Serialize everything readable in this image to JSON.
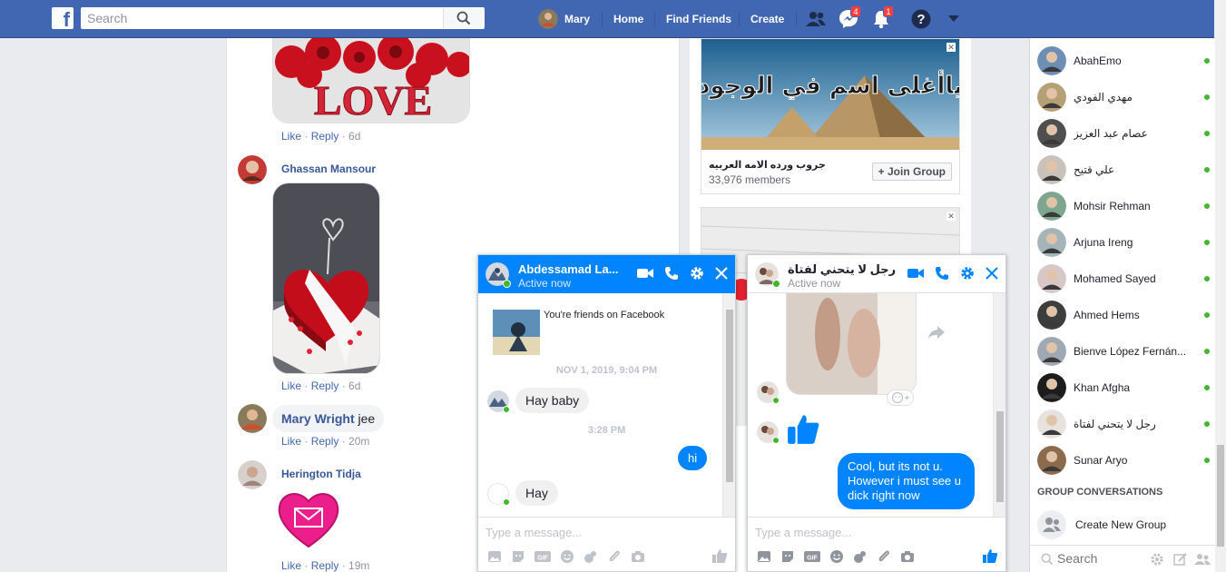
{
  "topbar": {
    "logo": "f",
    "search_placeholder": "Search",
    "user_name": "Mary",
    "home": "Home",
    "find_friends": "Find Friends",
    "create": "Create",
    "messenger_badge": "4",
    "notifications_badge": "1"
  },
  "feed": {
    "comments": [
      {
        "actions": {
          "like": "Like",
          "reply": "Reply",
          "time": "6d"
        }
      },
      {
        "name": "Ghassan Mansour",
        "actions": {
          "like": "Like",
          "reply": "Reply",
          "time": "6d"
        }
      },
      {
        "name": "Mary Wright",
        "text": "jee",
        "actions": {
          "like": "Like",
          "reply": "Reply",
          "time": "20m"
        }
      },
      {
        "name": "Herington Tidja",
        "actions": {
          "like": "Like",
          "reply": "Reply",
          "time": "19m"
        }
      }
    ],
    "love_image_text": "LOVE"
  },
  "ads": {
    "group_name": "جروب ورده الامه العربيه",
    "members": "33,976 members",
    "join_label": "+ Join Group",
    "banner_text": "ياأغلى اسم في الوجود"
  },
  "chat_windows": [
    {
      "title": "Abdessamad La...",
      "status": "Active now",
      "header_color": "#0084ff",
      "friends_note": "You're friends on Facebook",
      "date_stamp": "NOV 1, 2019, 9:04 PM",
      "msg1": "Hay baby",
      "time_stamp": "3:28 PM",
      "msg_out": "hi",
      "msg2": "Hay",
      "input_placeholder": "Type a message..."
    },
    {
      "title": "رجل لا يتحني لفتاة",
      "status": "Active now",
      "header_color": "#ffffff",
      "msg_out": "Cool, but its not u. However i must see u dick right now",
      "input_placeholder": "Type a message..."
    }
  ],
  "chat_sidebar": {
    "contacts": [
      {
        "name": "AbahEmo"
      },
      {
        "name": "مهدي الفودي"
      },
      {
        "name": "عصام عبد العزيز"
      },
      {
        "name": "علي قتيح"
      },
      {
        "name": "Mohsir Rehman"
      },
      {
        "name": "Arjuna Ireng"
      },
      {
        "name": "Mohamed Sayed"
      },
      {
        "name": "Ahmed Hems"
      },
      {
        "name": "Bienve López Fernán..."
      },
      {
        "name": "Khan Afgha"
      },
      {
        "name": "رجل لا يتحني لفتاة"
      },
      {
        "name": "Sunar Aryo"
      }
    ],
    "group_title": "GROUP CONVERSATIONS",
    "create_group": "Create New Group",
    "search_placeholder": "Search"
  },
  "colors": {
    "brand": "#4267b2",
    "messenger_blue": "#0084ff",
    "online": "#42b72a",
    "badge_red": "#fa3e3e"
  }
}
